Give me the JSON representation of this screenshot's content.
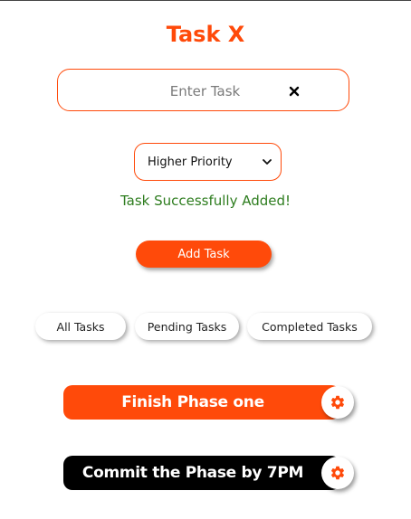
{
  "app": {
    "title": "Task X"
  },
  "form": {
    "task_placeholder": "Enter Task",
    "task_value": "",
    "priority_selected": "Higher Priority",
    "status_message": "Task Successfully Added!",
    "add_button_label": "Add Task"
  },
  "filters": [
    {
      "label": "All Tasks"
    },
    {
      "label": "Pending Tasks"
    },
    {
      "label": "Completed Tasks"
    }
  ],
  "tasks": [
    {
      "title": "Finish Phase one",
      "background": "#ff4a0a",
      "settings_icon": "gear-icon"
    },
    {
      "title": "Commit the Phase by 7PM",
      "background": "#000000",
      "settings_icon": "gear-icon"
    }
  ],
  "colors": {
    "accent": "#ff4a0a",
    "success": "#2e7d1f",
    "dark_card": "#000000"
  }
}
